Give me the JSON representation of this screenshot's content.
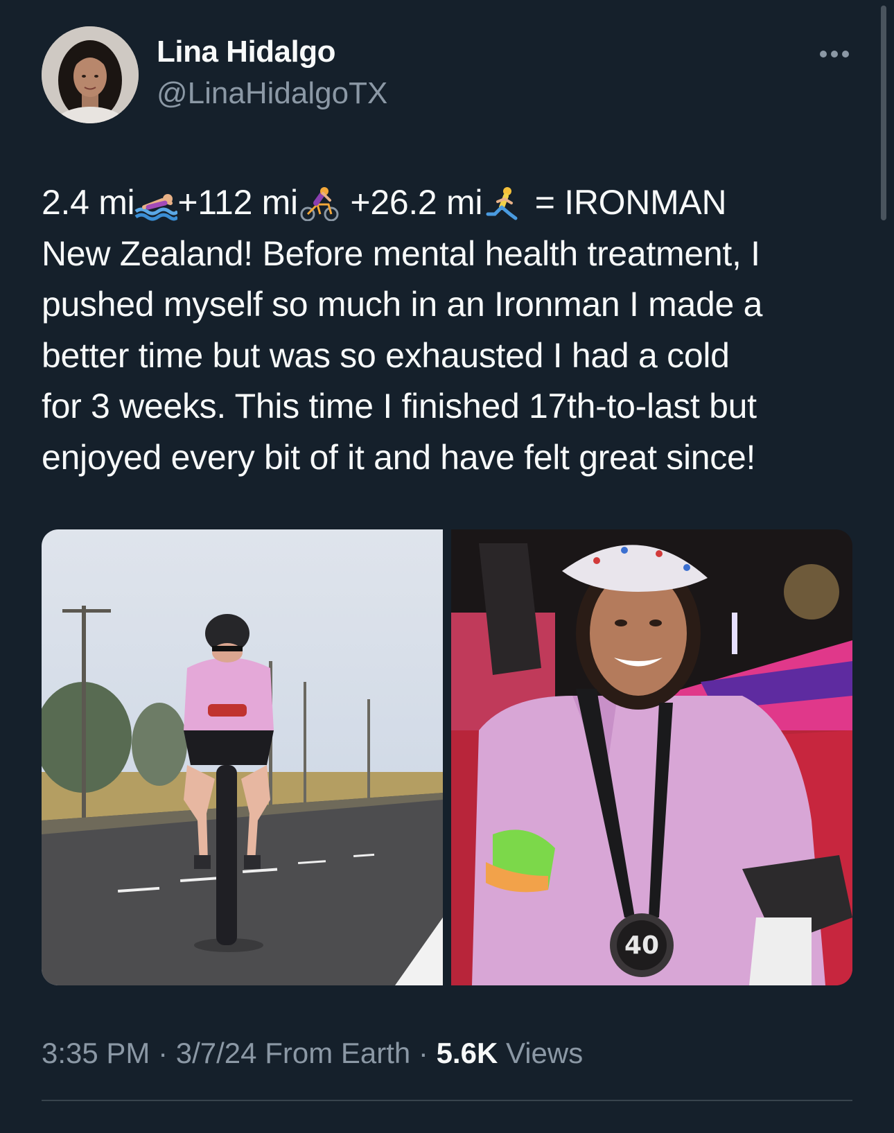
{
  "author": {
    "display_name": "Lina Hidalgo",
    "handle": "@LinaHidalgoTX"
  },
  "tweet": {
    "line1": {
      "a": "2.4 mi",
      "b": "+112 mi",
      "c": " +26.2 mi",
      "d": " = IRONMAN"
    },
    "line2": "New Zealand! Before mental health treatment, I",
    "line3": "pushed myself so much in an Ironman I made a",
    "line4": "better time but was so exhausted I had a cold",
    "line5": "for 3 weeks. This time I finished 17th-to-last but",
    "line6": "enjoyed every bit of it and have felt great since!"
  },
  "emoji_icons": [
    "swimmer-icon",
    "cyclist-icon",
    "runner-icon"
  ],
  "media": {
    "photo1": "cyclist-race-photo",
    "photo2": "finisher-medal-photo"
  },
  "meta": {
    "time": "3:35 PM",
    "separator": " · ",
    "date_source": "3/7/24 From Earth",
    "views_count": "5.6K",
    "views_label": " Views"
  },
  "colors": {
    "background": "#15202b",
    "text_primary": "#f7f9f9",
    "text_secondary": "#8b98a5",
    "divider": "#38444d"
  }
}
